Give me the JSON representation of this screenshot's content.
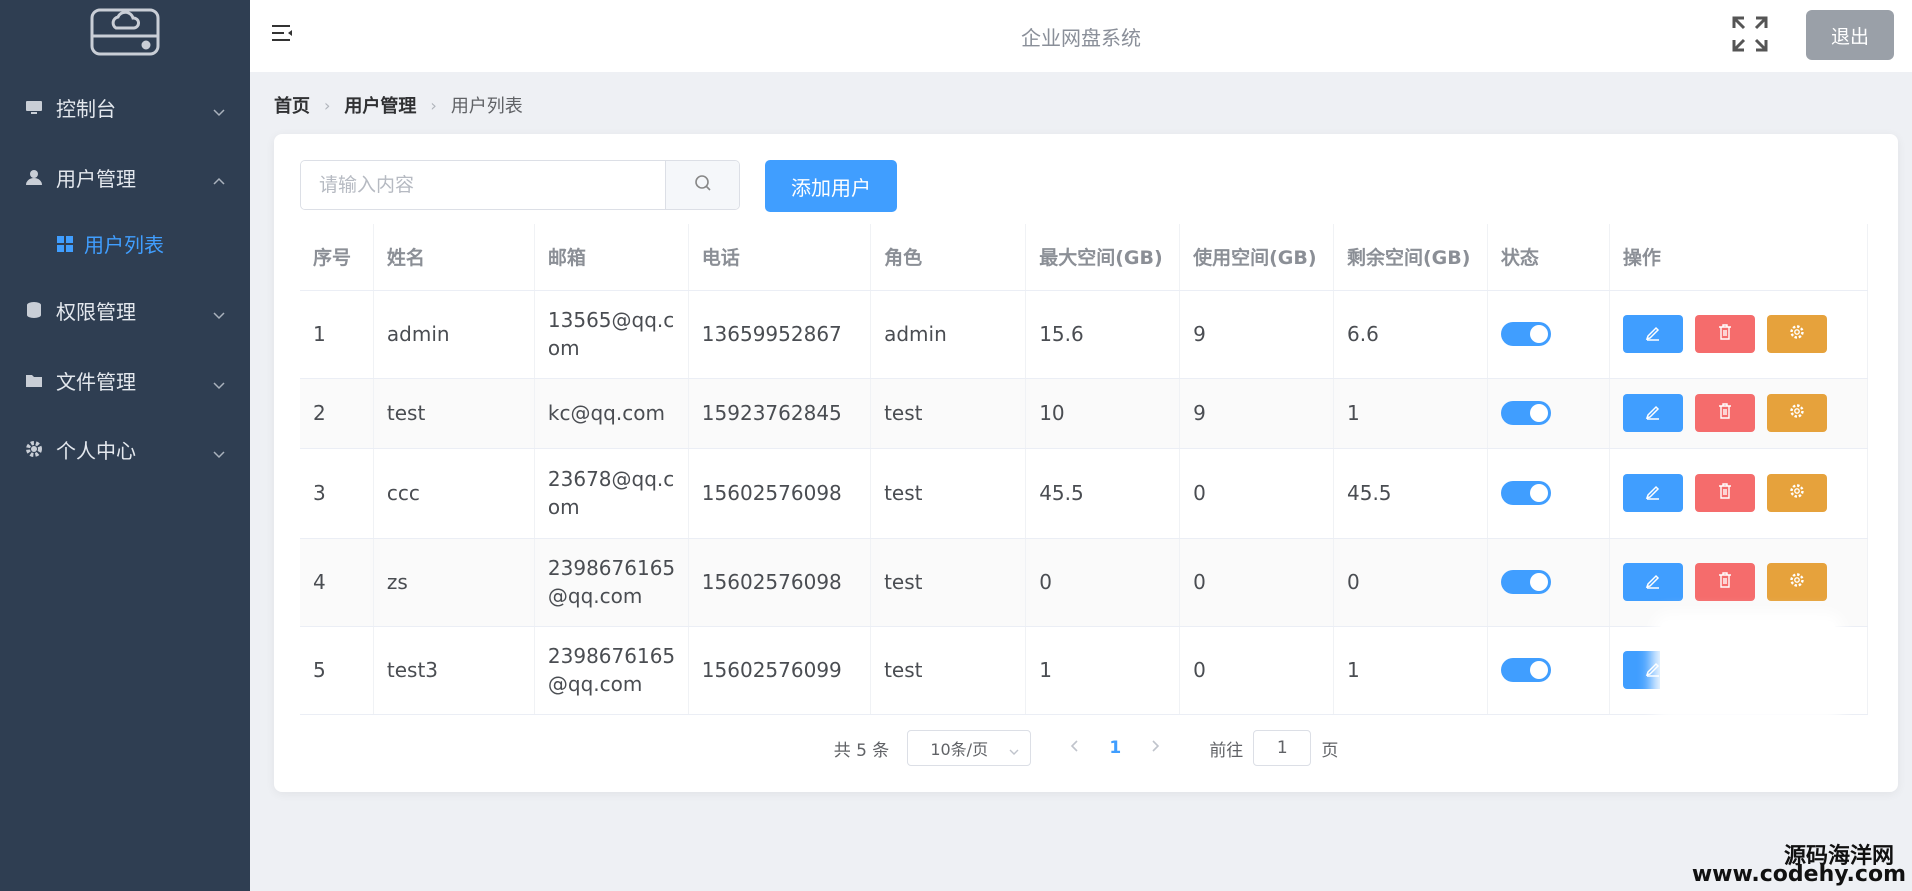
{
  "app": {
    "title": "企业网盘系统",
    "logout_label": "退出"
  },
  "sidebar": {
    "items": [
      {
        "label": "控制台",
        "icon": "monitor-icon"
      },
      {
        "label": "用户管理",
        "icon": "user-icon",
        "expanded": true,
        "children": [
          {
            "label": "用户列表",
            "icon": "grid-icon",
            "active": true
          }
        ]
      },
      {
        "label": "权限管理",
        "icon": "database-icon"
      },
      {
        "label": "文件管理",
        "icon": "folder-icon"
      },
      {
        "label": "个人中心",
        "icon": "gear-icon"
      }
    ]
  },
  "breadcrumb": [
    "首页",
    "用户管理",
    "用户列表"
  ],
  "toolbar": {
    "search_placeholder": "请输入内容",
    "add_label": "添加用户"
  },
  "table": {
    "columns": [
      "序号",
      "姓名",
      "邮箱",
      "电话",
      "角色",
      "最大空间(GB)",
      "使用空间(GB)",
      "剩余空间(GB)",
      "状态",
      "操作"
    ],
    "rows": [
      {
        "index": "1",
        "name": "admin",
        "email": "13565@qq.com",
        "phone": "13659952867",
        "role": "admin",
        "max": "15.6",
        "used": "9",
        "remain": "6.6",
        "status": true
      },
      {
        "index": "2",
        "name": "test",
        "email": "kc@qq.com",
        "phone": "15923762845",
        "role": "test",
        "max": "10",
        "used": "9",
        "remain": "1",
        "status": true
      },
      {
        "index": "3",
        "name": "ccc",
        "email": "23678@qq.com",
        "phone": "15602576098",
        "role": "test",
        "max": "45.5",
        "used": "0",
        "remain": "45.5",
        "status": true
      },
      {
        "index": "4",
        "name": "zs",
        "email": "2398676165@qq.com",
        "phone": "15602576098",
        "role": "test",
        "max": "0",
        "used": "0",
        "remain": "0",
        "status": true
      },
      {
        "index": "5",
        "name": "test3",
        "email": "2398676165@qq.com",
        "phone": "15602576099",
        "role": "test",
        "max": "1",
        "used": "0",
        "remain": "1",
        "status": true
      }
    ]
  },
  "pagination": {
    "total_text": "共 5 条",
    "page_size": "10条/页",
    "current_page": "1",
    "goto_label": "前往",
    "goto_value": "1",
    "page_suffix": "页"
  },
  "watermark": {
    "name": "源码海洋网",
    "url": "www.codehy.com"
  },
  "colors": {
    "sidebar": "#2f3e52",
    "primary": "#409eff",
    "danger": "#f56c6c",
    "warning": "#e6a23c",
    "logout": "#9aa0a8"
  }
}
